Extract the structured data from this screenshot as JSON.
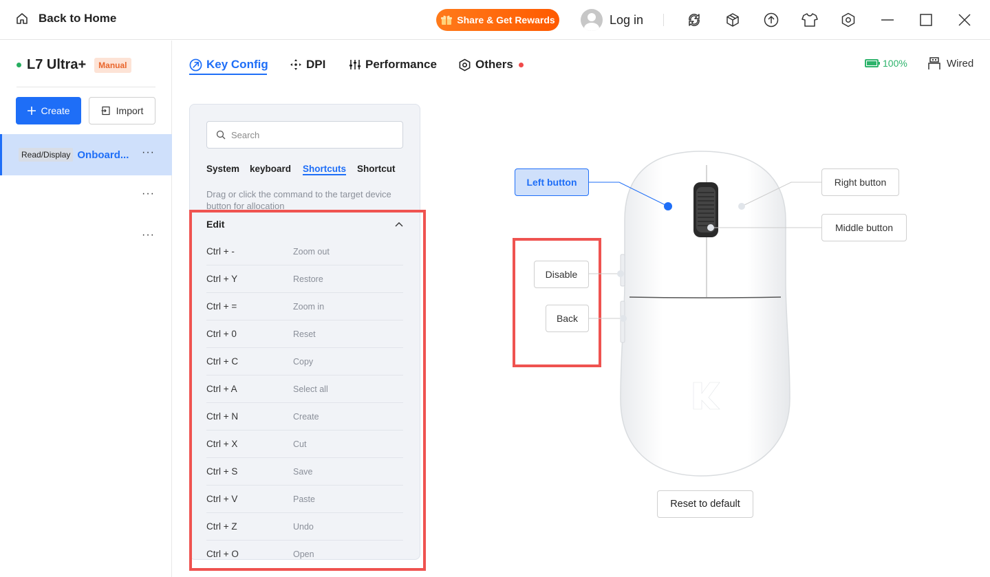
{
  "titlebar": {
    "back_label": "Back to Home",
    "share_label": "Share & Get Rewards",
    "login_label": "Log in"
  },
  "sidebar": {
    "device_name": "L7 Ultra+",
    "device_badge": "Manual",
    "create_label": "Create",
    "import_label": "Import",
    "profiles": [
      {
        "tag": "Read/Display",
        "name": "Onboard..."
      },
      {
        "tag": "",
        "name": ""
      },
      {
        "tag": "",
        "name": ""
      }
    ]
  },
  "tabs": [
    {
      "label": "Key Config",
      "icon": "key-config-icon"
    },
    {
      "label": "DPI",
      "icon": "dpi-icon"
    },
    {
      "label": "Performance",
      "icon": "performance-icon"
    },
    {
      "label": "Others",
      "icon": "others-icon"
    }
  ],
  "status": {
    "battery": "100%",
    "connection": "Wired"
  },
  "panel": {
    "search_placeholder": "Search",
    "categories": [
      "System",
      "keyboard",
      "Shortcuts",
      "Shortcut"
    ],
    "active_category": "Shortcuts",
    "hint": "Drag or click the command to the target device button for allocation",
    "group": "Edit",
    "commands": [
      {
        "key": "Ctrl + -",
        "desc": "Zoom out"
      },
      {
        "key": "Ctrl + Y",
        "desc": "Restore"
      },
      {
        "key": "Ctrl + =",
        "desc": "Zoom in"
      },
      {
        "key": "Ctrl + 0",
        "desc": "Reset"
      },
      {
        "key": "Ctrl + C",
        "desc": "Copy"
      },
      {
        "key": "Ctrl + A",
        "desc": "Select all"
      },
      {
        "key": "Ctrl + N",
        "desc": "Create"
      },
      {
        "key": "Ctrl + X",
        "desc": "Cut"
      },
      {
        "key": "Ctrl + S",
        "desc": "Save"
      },
      {
        "key": "Ctrl + V",
        "desc": "Paste"
      },
      {
        "key": "Ctrl + Z",
        "desc": "Undo"
      },
      {
        "key": "Ctrl + O",
        "desc": "Open"
      }
    ]
  },
  "mouse": {
    "left_button": "Left button",
    "right_button": "Right button",
    "middle_button": "Middle button",
    "side_front": "Disable",
    "side_back": "Back",
    "reset_label": "Reset to default"
  },
  "colors": {
    "accent": "#1e6ef7",
    "share": "#ff6a00",
    "battery": "#2db36b",
    "highlight": "#ef5350"
  }
}
